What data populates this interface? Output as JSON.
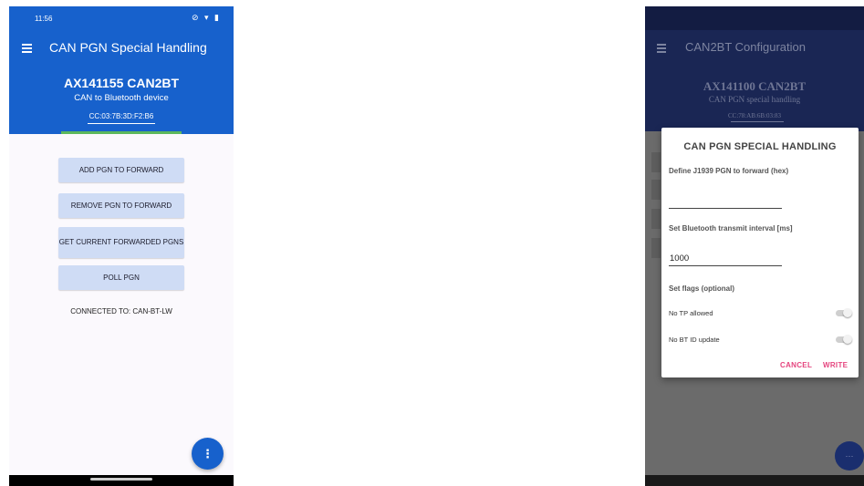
{
  "left_screen": {
    "status_bar": {
      "time": "11:56",
      "icons": "⊘ ▾ ▮"
    },
    "app_bar": {
      "menu_icon": "hamburger-menu-icon",
      "title": "CAN PGN Special Handling"
    },
    "device": {
      "name": "AX141155 CAN2BT",
      "subtitle": "CAN to Bluetooth device",
      "mac": "CC:03:7B:3D:F2:B6"
    },
    "buttons": [
      {
        "label": "ADD PGN TO FORWARD"
      },
      {
        "label": "REMOVE PGN TO FORWARD"
      },
      {
        "label": "GET CURRENT FORWARDED PGNS"
      },
      {
        "label": "POLL PGN"
      }
    ],
    "connected_text": "CONNECTED TO: CAN-BT-LW",
    "fab_icon": "⋮",
    "colors": {
      "primary": "#1761cc",
      "button_bg": "#cfdcf5",
      "progress": "#5cb85c"
    }
  },
  "right_screen": {
    "app_bar": {
      "menu_icon": "hamburger-menu-icon",
      "title": "CAN2BT Configuration"
    },
    "device": {
      "name": "AX141100 CAN2BT",
      "subtitle": "CAN PGN special handling",
      "mac": "CC:78:AB:6B:03:83"
    },
    "dialog": {
      "title": "CAN PGN SPECIAL HANDLING",
      "pgn_label": "Define J1939 PGN to forward (hex)",
      "pgn_value": "",
      "interval_label": "Set Bluetooth transmit interval [ms]",
      "interval_value": "1000",
      "flags_label": "Set flags (optional)",
      "flags": [
        {
          "label": "No TP allowed",
          "on": false
        },
        {
          "label": "No BT ID update",
          "on": false
        }
      ],
      "cancel_label": "CANCEL",
      "write_label": "WRITE"
    },
    "fab_icon": "···",
    "colors": {
      "header": "#1a2654",
      "accent": "#e5447e"
    }
  }
}
